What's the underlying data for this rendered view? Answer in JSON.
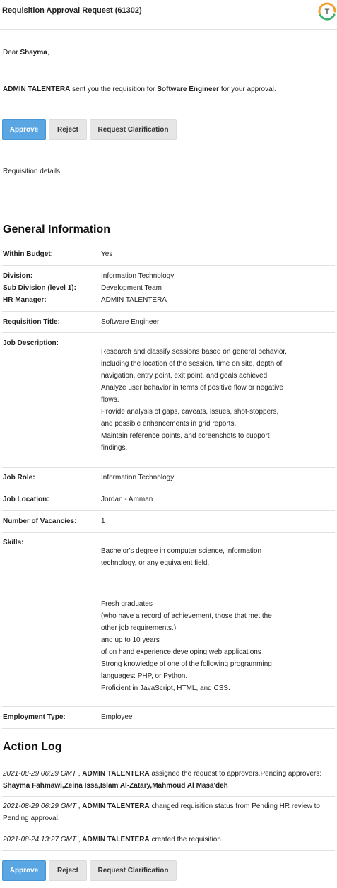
{
  "header": {
    "title": "Requisition Approval Request (61302)",
    "logo_letter": "T",
    "logo_colors": {
      "orange": "#f0a22e",
      "green": "#3cb371",
      "gray": "#888888"
    }
  },
  "greeting": {
    "prefix": "Dear",
    "name": "Shayma",
    "suffix": ","
  },
  "intro": {
    "sender": "ADMIN TALENTERA",
    "text1": "sent you the requisition for",
    "job": "Software Engineer",
    "text2": "for your approval."
  },
  "buttons": {
    "approve": "Approve",
    "reject": "Reject",
    "clarify": "Request Clarification",
    "approve_color": "#5aa6e3"
  },
  "requisition_details_label": "Requisition details:",
  "general": {
    "heading": "General Information",
    "within_budget_label": "Within Budget:",
    "within_budget": "Yes",
    "division_label": "Division:",
    "division": "Information Technology",
    "subdivision_label": "Sub Division (level 1):",
    "subdivision": "Development Team",
    "hr_manager_label": "HR Manager:",
    "hr_manager": "ADMIN TALENTERA",
    "req_title_label": "Requisition Title:",
    "req_title": "Software Engineer",
    "job_desc_label": "Job Description:",
    "job_desc": [
      "Research and classify sessions based on general behavior,",
      "including the location of the session, time on site, depth of",
      "navigation, entry point, exit point, and goals achieved.",
      "Analyze user behavior in terms of positive flow or negative",
      "flows.",
      "Provide analysis of gaps, caveats, issues, shot-stoppers,",
      "and possible enhancements in grid reports.",
      "Maintain reference points, and screenshots to support",
      "findings."
    ],
    "job_role_label": "Job Role:",
    "job_role": "Information Technology",
    "job_location_label": "Job Location:",
    "job_location": "Jordan - Amman",
    "vacancies_label": "Number of Vacancies:",
    "vacancies": "1",
    "skills_label": "Skills:",
    "skills_block1": [
      "Bachelor's degree in computer science, information",
      "technology, or any equivalent field."
    ],
    "skills_block2": [
      "Fresh graduates",
      "(who have a record of achievement, those that met the",
      "other job requirements.)",
      "and up to 10 years",
      "of on hand experience developing web applications",
      "Strong knowledge of one of the following programming",
      "languages: PHP, or Python.",
      "Proficient in JavaScript, HTML, and CSS."
    ],
    "employment_type_label": "Employment Type:",
    "employment_type": "Employee"
  },
  "action_log": {
    "heading": "Action Log",
    "entries": [
      {
        "time": "2021-08-29 06:29 GMT",
        "actor": "ADMIN TALENTERA",
        "text": "assigned the request to approvers.Pending approvers:",
        "bold_tail": "Shayma Fahmawi,Zeina Issa,Islam Al-Zatary,Mahmoud Al Masa'deh"
      },
      {
        "time": "2021-08-29 06:29 GMT",
        "actor": "ADMIN TALENTERA",
        "text": "changed requisition status from Pending HR review to Pending approval.",
        "bold_tail": ""
      },
      {
        "time": "2021-08-24 13:27 GMT",
        "actor": "ADMIN TALENTERA",
        "text": "created the requisition.",
        "bold_tail": ""
      }
    ]
  }
}
